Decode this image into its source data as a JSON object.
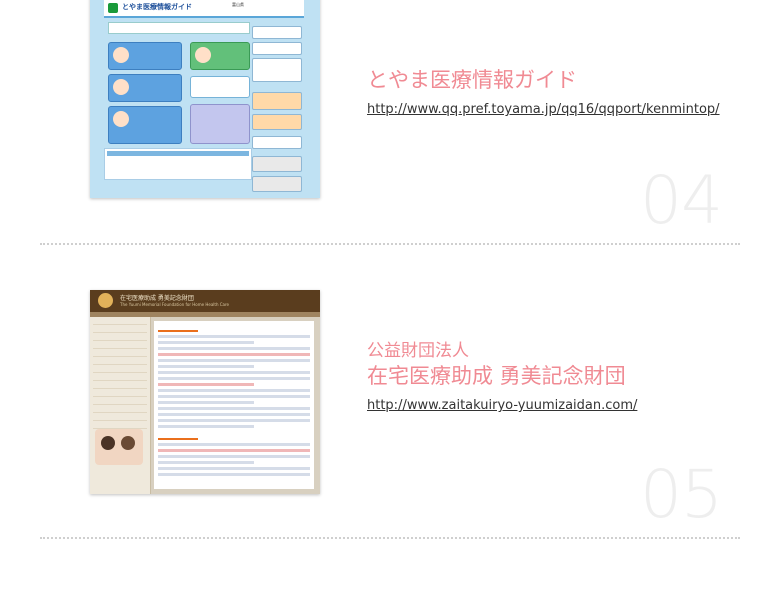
{
  "entries": [
    {
      "thumbnail": {
        "header_title": "とやま医療情報ガイド",
        "header_badge": "富山県"
      },
      "org": "",
      "title": "とやま医療情報ガイド",
      "url": "http://www.qq.pref.toyama.jp/qq16/qqport/kenmintop/",
      "number": "04"
    },
    {
      "thumbnail": {
        "header_title": "在宅医療助成 勇美記念財団",
        "header_sub": "The Yuumi Memorial Foundation for Home Health Care"
      },
      "org": "公益財団法人",
      "title": "在宅医療助成 勇美記念財団",
      "url": "http://www.zaitakuiryo-yuumizaidan.com/",
      "number": "05"
    }
  ],
  "colors": {
    "title": "#f08a93",
    "number": "#eeeeee",
    "divider": "#cfcfcf"
  }
}
